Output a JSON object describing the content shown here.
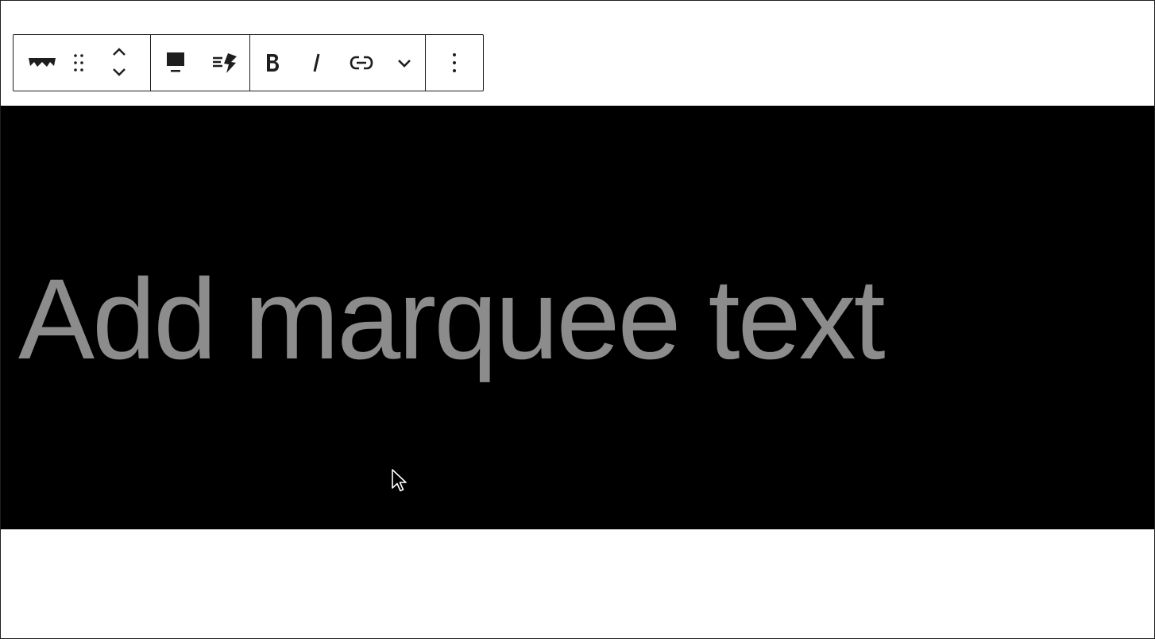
{
  "editor": {
    "marquee_placeholder": "Add marquee text",
    "marquee_background": "#000000",
    "placeholder_color": "#8c8c8c"
  },
  "toolbar": {
    "block_icon": "marquee-block-icon",
    "drag_icon": "drag-handle-icon",
    "move_up_icon": "chevron-up-icon",
    "move_down_icon": "chevron-down-icon",
    "align_icon": "align-full-icon",
    "animation_icon": "speed-icon",
    "bold_icon": "bold-icon",
    "italic_icon": "italic-icon",
    "link_icon": "link-icon",
    "more_formatting_icon": "chevron-down-icon",
    "options_icon": "more-vertical-icon"
  }
}
